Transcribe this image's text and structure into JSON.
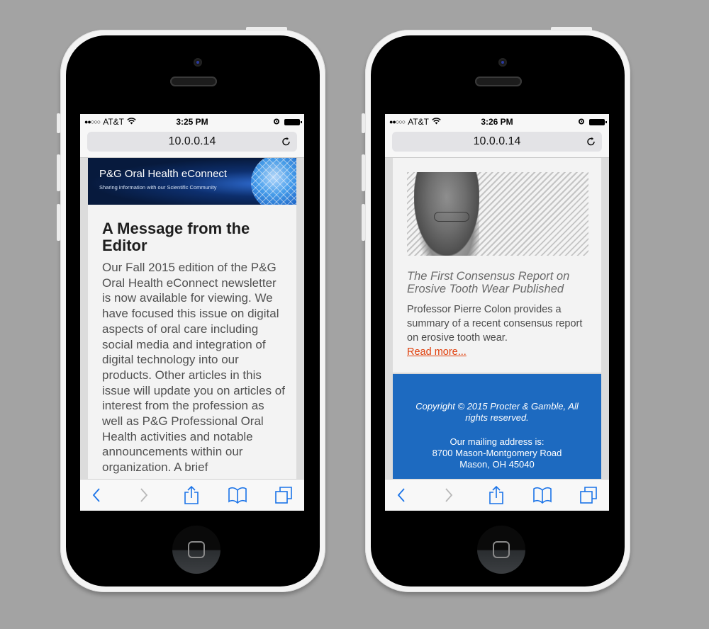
{
  "phones": [
    {
      "status": {
        "carrier": "AT&T",
        "signal_dots": "●●○○○",
        "time": "3:25 PM"
      },
      "url": "10.0.0.14",
      "banner": {
        "title": "P&G Oral Health eConnect",
        "subtitle": "Sharing information with our Scientific Community"
      },
      "article": {
        "heading": "A Message from the Editor",
        "body": "Our Fall 2015 edition of the P&G Oral Health eConnect newsletter is now available for viewing. We have focused this issue on digital aspects of oral care including social media and integration of digital technology into our products. Other articles in this issue will update you on articles of interest from the profession as well as P&G Professional Oral Health activities and notable announcements within our organization. A brief"
      },
      "toolbar": [
        "back-icon",
        "forward-icon",
        "share-icon",
        "bookmarks-icon",
        "tabs-icon"
      ]
    },
    {
      "status": {
        "carrier": "AT&T",
        "signal_dots": "●●○○○",
        "time": "3:26 PM"
      },
      "url": "10.0.0.14",
      "article": {
        "title": "The First Consensus Report on Erosive Tooth Wear Published",
        "body": "Professor Pierre Colon provides a summary of a recent consensus report on erosive tooth wear.",
        "link": "Read more..."
      },
      "footer": {
        "copyright": "Copyright © 2015 Procter & Gamble, All rights reserved.",
        "mailing_label": "Our mailing address is:",
        "street": "8700 Mason-Montgomery Road",
        "city": "Mason, OH 45040"
      },
      "toolbar": [
        "back-icon",
        "forward-icon",
        "share-icon",
        "bookmarks-icon",
        "tabs-icon"
      ]
    }
  ],
  "colors": {
    "accent_blue": "#1a73e8",
    "footer_blue": "#1d6ac0",
    "link_orange": "#e0400d"
  }
}
